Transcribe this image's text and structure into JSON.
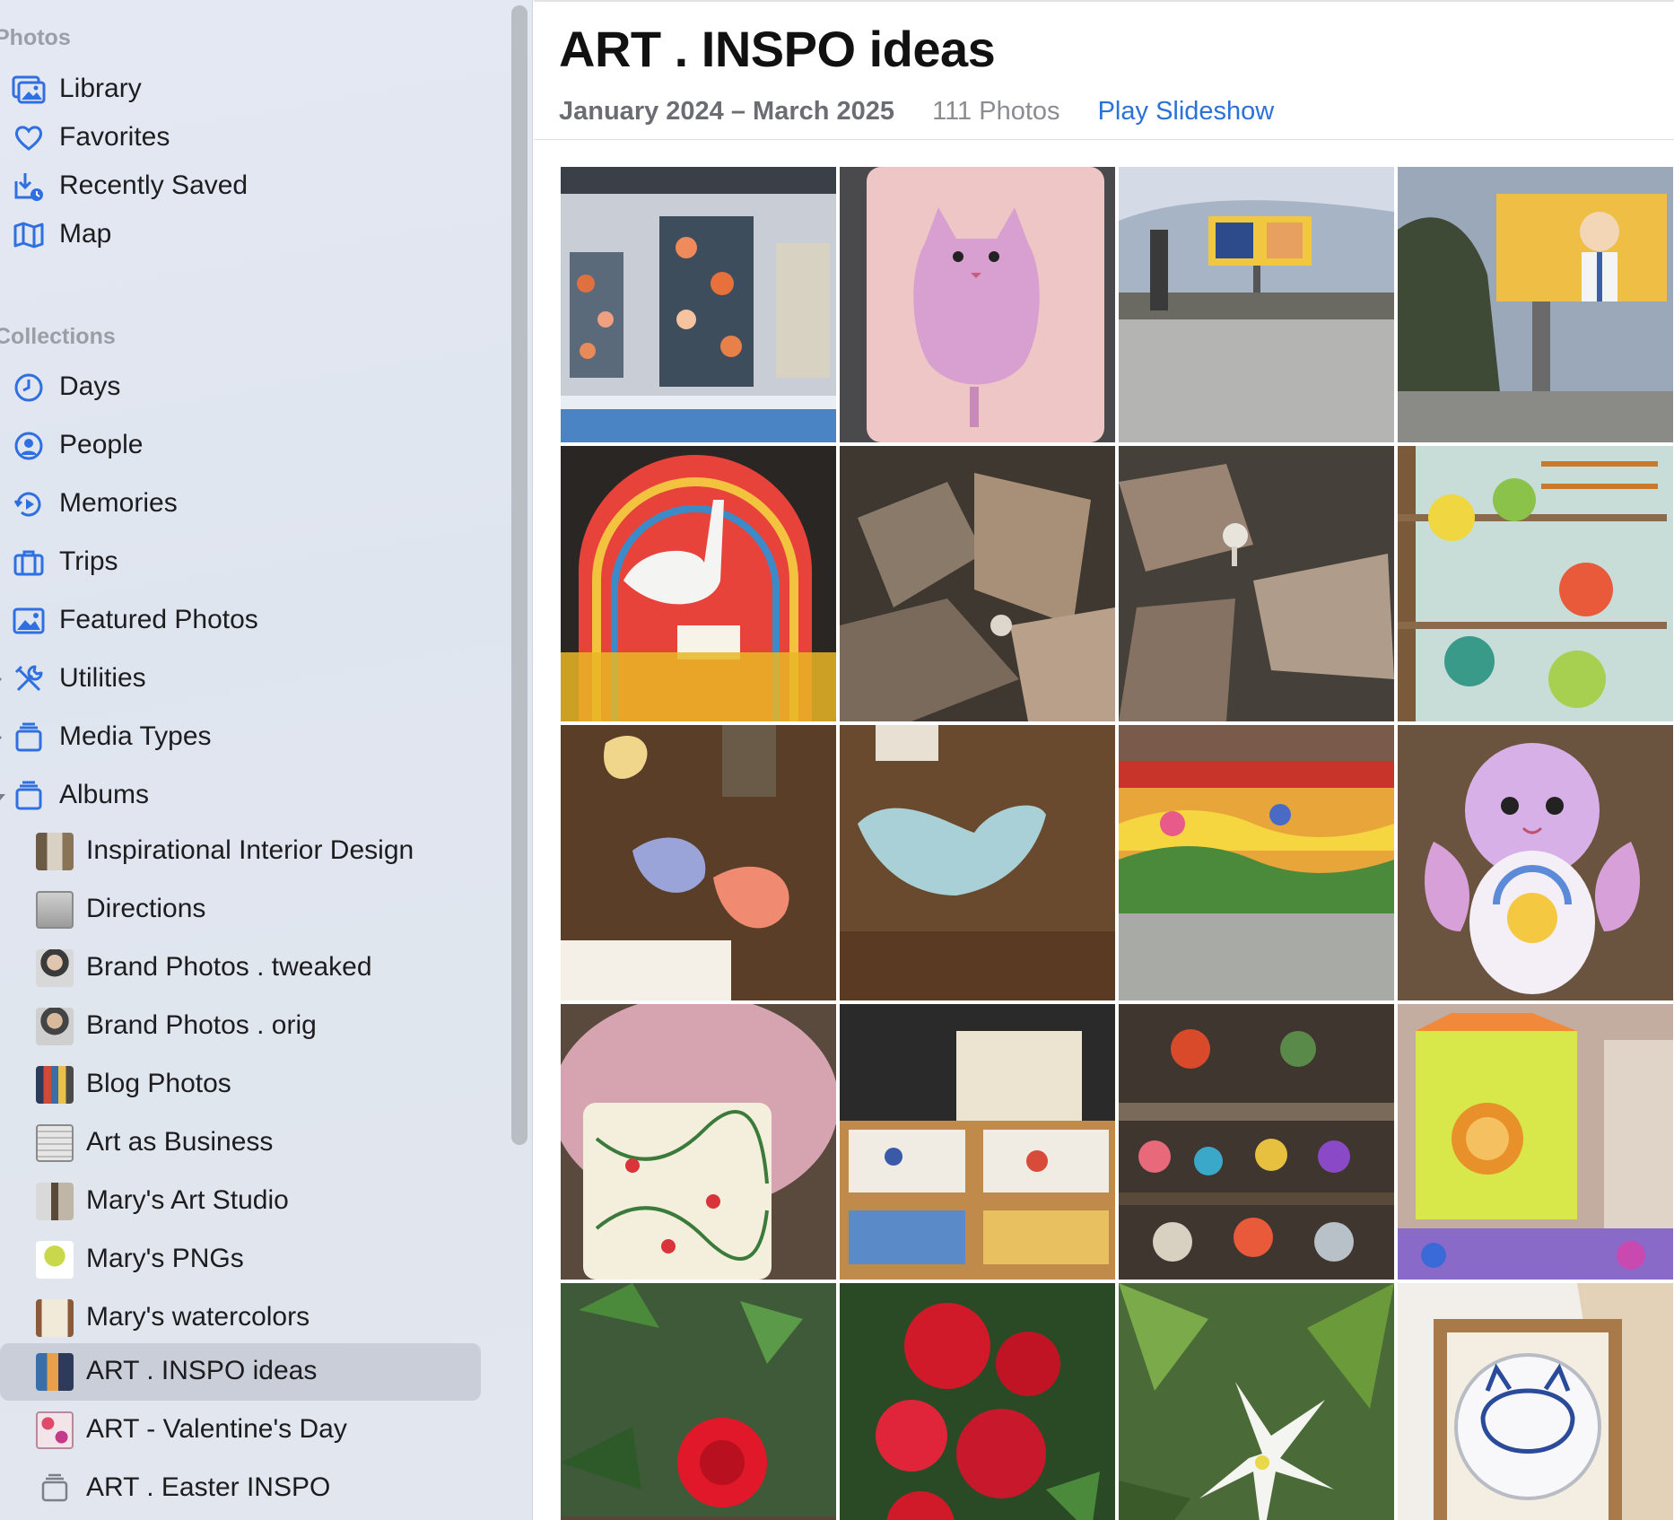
{
  "sidebar": {
    "sections": {
      "photos": "Photos",
      "collections": "Collections"
    },
    "top_items": [
      {
        "label": "Library",
        "icon": "library-icon"
      },
      {
        "label": "Favorites",
        "icon": "heart-icon"
      },
      {
        "label": "Recently Saved",
        "icon": "recently-saved-icon"
      },
      {
        "label": "Map",
        "icon": "map-icon"
      }
    ],
    "collection_items": [
      {
        "label": "Days",
        "icon": "clock-icon"
      },
      {
        "label": "People",
        "icon": "person-circle-icon"
      },
      {
        "label": "Memories",
        "icon": "memories-icon"
      },
      {
        "label": "Trips",
        "icon": "suitcase-icon"
      },
      {
        "label": "Featured Photos",
        "icon": "photo-icon"
      },
      {
        "label": "Utilities",
        "icon": "tools-icon"
      },
      {
        "label": "Media Types",
        "icon": "stack-icon"
      },
      {
        "label": "Albums",
        "icon": "stack-icon"
      }
    ],
    "albums": [
      {
        "label": "Inspirational Interior Design"
      },
      {
        "label": "Directions"
      },
      {
        "label": "Brand Photos . tweaked"
      },
      {
        "label": "Brand Photos . orig"
      },
      {
        "label": "Blog Photos"
      },
      {
        "label": "Art as Business"
      },
      {
        "label": "Mary's Art Studio"
      },
      {
        "label": "Mary's PNGs"
      },
      {
        "label": "Mary's watercolors"
      },
      {
        "label": "ART . INSPO ideas",
        "selected": true
      },
      {
        "label": "ART - Valentine's Day"
      },
      {
        "label": "ART . Easter INSPO"
      }
    ]
  },
  "album": {
    "title": "ART . INSPO ideas",
    "date_range": "January 2024 – March 2025",
    "photo_count": "111 Photos",
    "slideshow_label": "Play Slideshow"
  },
  "colors": {
    "accent": "#2a71d8",
    "selected_row": "#c9ced8"
  }
}
